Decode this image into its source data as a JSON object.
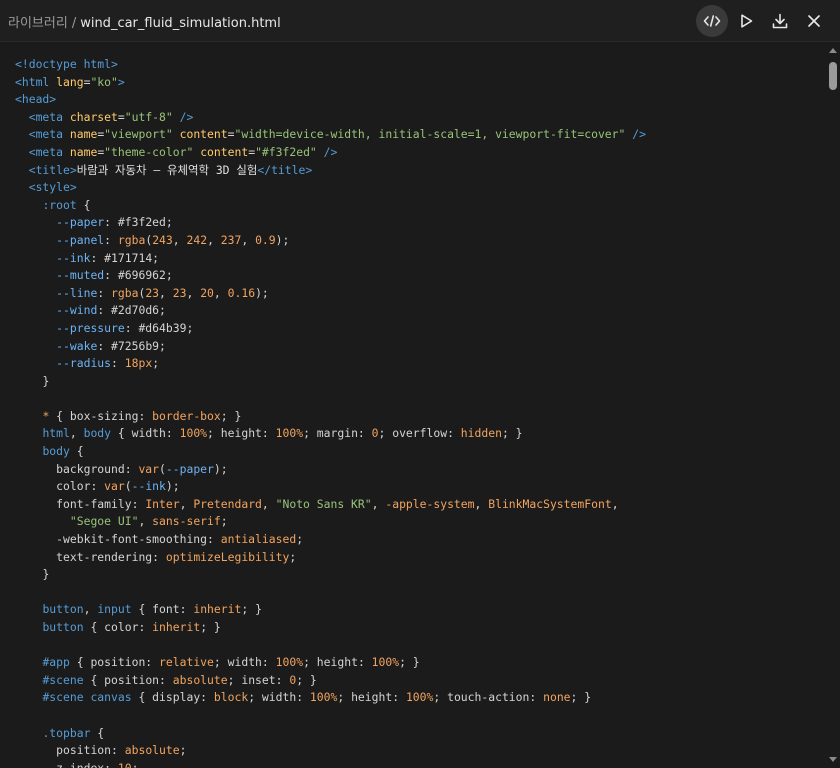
{
  "header": {
    "library": "라이브러리",
    "separator": "/",
    "filename": "wind_car_fluid_simulation.html",
    "actions": [
      {
        "name": "code-view-button",
        "icon": "code-icon",
        "active": true
      },
      {
        "name": "run-button",
        "icon": "play-icon",
        "active": false
      },
      {
        "name": "download-button",
        "icon": "download-icon",
        "active": false
      },
      {
        "name": "close-button",
        "icon": "close-icon",
        "active": false
      }
    ]
  },
  "colors": {
    "background": "#1b1b1b",
    "tag": "#569cd6",
    "attribute": "#ffcb6b",
    "string": "#98c379",
    "value": "#f2a460",
    "variable": "#6cb3f5"
  },
  "code_lines": [
    [
      [
        "tag",
        "<!doctype html>"
      ]
    ],
    [
      [
        "tag",
        "<html "
      ],
      [
        "attr",
        "lang"
      ],
      [
        "pun",
        "="
      ],
      [
        "str",
        "\"ko\""
      ],
      [
        "tag",
        ">"
      ]
    ],
    [
      [
        "tag",
        "<head>"
      ]
    ],
    [
      [
        "txt",
        "  "
      ],
      [
        "tag",
        "<meta "
      ],
      [
        "attr",
        "charset"
      ],
      [
        "pun",
        "="
      ],
      [
        "str",
        "\"utf-8\""
      ],
      [
        "tag",
        " />"
      ]
    ],
    [
      [
        "txt",
        "  "
      ],
      [
        "tag",
        "<meta "
      ],
      [
        "attr",
        "name"
      ],
      [
        "pun",
        "="
      ],
      [
        "str",
        "\"viewport\""
      ],
      [
        "txt",
        " "
      ],
      [
        "attr",
        "content"
      ],
      [
        "pun",
        "="
      ],
      [
        "str",
        "\"width=device-width, initial-scale=1, viewport-fit=cover\""
      ],
      [
        "tag",
        " />"
      ]
    ],
    [
      [
        "txt",
        "  "
      ],
      [
        "tag",
        "<meta "
      ],
      [
        "attr",
        "name"
      ],
      [
        "pun",
        "="
      ],
      [
        "str",
        "\"theme-color\""
      ],
      [
        "txt",
        " "
      ],
      [
        "attr",
        "content"
      ],
      [
        "pun",
        "="
      ],
      [
        "str",
        "\"#f3f2ed\""
      ],
      [
        "tag",
        " />"
      ]
    ],
    [
      [
        "txt",
        "  "
      ],
      [
        "tag",
        "<title>"
      ],
      [
        "txt",
        "바람과 자동차 — 유체역학 3D 실험"
      ],
      [
        "tag",
        "</title>"
      ]
    ],
    [
      [
        "txt",
        "  "
      ],
      [
        "tag",
        "<style>"
      ]
    ],
    [
      [
        "txt",
        "    "
      ],
      [
        "sel",
        ":root"
      ],
      [
        "pun",
        " {"
      ]
    ],
    [
      [
        "txt",
        "      "
      ],
      [
        "var",
        "--paper"
      ],
      [
        "pun",
        ": #f3f2ed;"
      ]
    ],
    [
      [
        "txt",
        "      "
      ],
      [
        "var",
        "--panel"
      ],
      [
        "pun",
        ": "
      ],
      [
        "val",
        "rgba"
      ],
      [
        "pun",
        "("
      ],
      [
        "num",
        "243"
      ],
      [
        "pun",
        ", "
      ],
      [
        "num",
        "242"
      ],
      [
        "pun",
        ", "
      ],
      [
        "num",
        "237"
      ],
      [
        "pun",
        ", "
      ],
      [
        "num",
        "0.9"
      ],
      [
        "pun",
        ");"
      ]
    ],
    [
      [
        "txt",
        "      "
      ],
      [
        "var",
        "--ink"
      ],
      [
        "pun",
        ": #171714;"
      ]
    ],
    [
      [
        "txt",
        "      "
      ],
      [
        "var",
        "--muted"
      ],
      [
        "pun",
        ": #696962;"
      ]
    ],
    [
      [
        "txt",
        "      "
      ],
      [
        "var",
        "--line"
      ],
      [
        "pun",
        ": "
      ],
      [
        "val",
        "rgba"
      ],
      [
        "pun",
        "("
      ],
      [
        "num",
        "23"
      ],
      [
        "pun",
        ", "
      ],
      [
        "num",
        "23"
      ],
      [
        "pun",
        ", "
      ],
      [
        "num",
        "20"
      ],
      [
        "pun",
        ", "
      ],
      [
        "num",
        "0.16"
      ],
      [
        "pun",
        ");"
      ]
    ],
    [
      [
        "txt",
        "      "
      ],
      [
        "var",
        "--wind"
      ],
      [
        "pun",
        ": #2d70d6;"
      ]
    ],
    [
      [
        "txt",
        "      "
      ],
      [
        "var",
        "--pressure"
      ],
      [
        "pun",
        ": #d64b39;"
      ]
    ],
    [
      [
        "txt",
        "      "
      ],
      [
        "var",
        "--wake"
      ],
      [
        "pun",
        ": #7256b9;"
      ]
    ],
    [
      [
        "txt",
        "      "
      ],
      [
        "var",
        "--radius"
      ],
      [
        "pun",
        ": "
      ],
      [
        "num",
        "18px"
      ],
      [
        "pun",
        ";"
      ]
    ],
    [
      [
        "txt",
        "    "
      ],
      [
        "pun",
        "}"
      ]
    ],
    [
      [
        "txt",
        ""
      ]
    ],
    [
      [
        "txt",
        "    "
      ],
      [
        "star",
        "*"
      ],
      [
        "pun",
        " { box-sizing: "
      ],
      [
        "val",
        "border-box"
      ],
      [
        "pun",
        "; }"
      ]
    ],
    [
      [
        "txt",
        "    "
      ],
      [
        "sel",
        "html"
      ],
      [
        "pun",
        ", "
      ],
      [
        "sel",
        "body"
      ],
      [
        "pun",
        " { width: "
      ],
      [
        "num",
        "100%"
      ],
      [
        "pun",
        "; height: "
      ],
      [
        "num",
        "100%"
      ],
      [
        "pun",
        "; margin: "
      ],
      [
        "num",
        "0"
      ],
      [
        "pun",
        "; overflow: "
      ],
      [
        "val",
        "hidden"
      ],
      [
        "pun",
        "; }"
      ]
    ],
    [
      [
        "txt",
        "    "
      ],
      [
        "sel",
        "body"
      ],
      [
        "pun",
        " {"
      ]
    ],
    [
      [
        "txt",
        "      "
      ],
      [
        "prop",
        "background"
      ],
      [
        "pun",
        ": "
      ],
      [
        "val",
        "var"
      ],
      [
        "pun",
        "("
      ],
      [
        "var",
        "--paper"
      ],
      [
        "pun",
        ");"
      ]
    ],
    [
      [
        "txt",
        "      "
      ],
      [
        "prop",
        "color"
      ],
      [
        "pun",
        ": "
      ],
      [
        "val",
        "var"
      ],
      [
        "pun",
        "("
      ],
      [
        "var",
        "--ink"
      ],
      [
        "pun",
        ");"
      ]
    ],
    [
      [
        "txt",
        "      "
      ],
      [
        "prop",
        "font-family"
      ],
      [
        "pun",
        ": "
      ],
      [
        "val",
        "Inter"
      ],
      [
        "pun",
        ", "
      ],
      [
        "val",
        "Pretendard"
      ],
      [
        "pun",
        ", "
      ],
      [
        "str",
        "\"Noto Sans KR\""
      ],
      [
        "pun",
        ", "
      ],
      [
        "val",
        "-apple-system"
      ],
      [
        "pun",
        ", "
      ],
      [
        "val",
        "BlinkMacSystemFont"
      ],
      [
        "pun",
        ","
      ]
    ],
    [
      [
        "txt",
        "        "
      ],
      [
        "str",
        "\"Segoe UI\""
      ],
      [
        "pun",
        ", "
      ],
      [
        "val",
        "sans-serif"
      ],
      [
        "pun",
        ";"
      ]
    ],
    [
      [
        "txt",
        "      "
      ],
      [
        "prop",
        "-webkit-font-smoothing"
      ],
      [
        "pun",
        ": "
      ],
      [
        "val",
        "antialiased"
      ],
      [
        "pun",
        ";"
      ]
    ],
    [
      [
        "txt",
        "      "
      ],
      [
        "prop",
        "text-rendering"
      ],
      [
        "pun",
        ": "
      ],
      [
        "val",
        "optimizeLegibility"
      ],
      [
        "pun",
        ";"
      ]
    ],
    [
      [
        "txt",
        "    "
      ],
      [
        "pun",
        "}"
      ]
    ],
    [
      [
        "txt",
        ""
      ]
    ],
    [
      [
        "txt",
        "    "
      ],
      [
        "sel",
        "button"
      ],
      [
        "pun",
        ", "
      ],
      [
        "sel",
        "input"
      ],
      [
        "pun",
        " { font: "
      ],
      [
        "val",
        "inherit"
      ],
      [
        "pun",
        "; }"
      ]
    ],
    [
      [
        "txt",
        "    "
      ],
      [
        "sel",
        "button"
      ],
      [
        "pun",
        " { color: "
      ],
      [
        "val",
        "inherit"
      ],
      [
        "pun",
        "; }"
      ]
    ],
    [
      [
        "txt",
        ""
      ]
    ],
    [
      [
        "txt",
        "    "
      ],
      [
        "sel",
        "#app"
      ],
      [
        "pun",
        " { position: "
      ],
      [
        "val",
        "relative"
      ],
      [
        "pun",
        "; width: "
      ],
      [
        "num",
        "100%"
      ],
      [
        "pun",
        "; height: "
      ],
      [
        "num",
        "100%"
      ],
      [
        "pun",
        "; }"
      ]
    ],
    [
      [
        "txt",
        "    "
      ],
      [
        "sel",
        "#scene"
      ],
      [
        "pun",
        " { position: "
      ],
      [
        "val",
        "absolute"
      ],
      [
        "pun",
        "; inset: "
      ],
      [
        "num",
        "0"
      ],
      [
        "pun",
        "; }"
      ]
    ],
    [
      [
        "txt",
        "    "
      ],
      [
        "sel",
        "#scene canvas"
      ],
      [
        "pun",
        " { display: "
      ],
      [
        "val",
        "block"
      ],
      [
        "pun",
        "; width: "
      ],
      [
        "num",
        "100%"
      ],
      [
        "pun",
        "; height: "
      ],
      [
        "num",
        "100%"
      ],
      [
        "pun",
        "; touch-action: "
      ],
      [
        "val",
        "none"
      ],
      [
        "pun",
        "; }"
      ]
    ],
    [
      [
        "txt",
        ""
      ]
    ],
    [
      [
        "txt",
        "    "
      ],
      [
        "sel",
        ".topbar"
      ],
      [
        "pun",
        " {"
      ]
    ],
    [
      [
        "txt",
        "      "
      ],
      [
        "prop",
        "position"
      ],
      [
        "pun",
        ": "
      ],
      [
        "val",
        "absolute"
      ],
      [
        "pun",
        ";"
      ]
    ],
    [
      [
        "txt",
        "      "
      ],
      [
        "prop",
        "z-index"
      ],
      [
        "pun",
        ": "
      ],
      [
        "num",
        "10"
      ],
      [
        "pun",
        ";"
      ]
    ]
  ]
}
